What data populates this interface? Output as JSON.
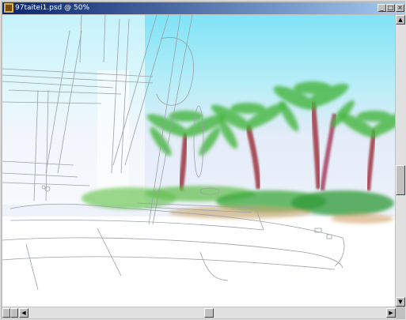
{
  "window": {
    "title": "97taitei1.psd @ 50%",
    "controls": {
      "minimize": "_",
      "maximize": "□",
      "close": "×"
    }
  },
  "canvas": {
    "subject": "sketch-palm-beach-illustration"
  },
  "scrollbars": {
    "vertical": {
      "up_arrow": "▲",
      "down_arrow": "▼"
    },
    "horizontal": {
      "left_arrow": "◀",
      "right_arrow": "▶"
    }
  },
  "colors": {
    "titlebar_start": "#08246b",
    "titlebar_end": "#a6caf0",
    "sky_top": "#7fe3f7",
    "foliage": "#45b53c",
    "trunk": "#a8505c"
  }
}
